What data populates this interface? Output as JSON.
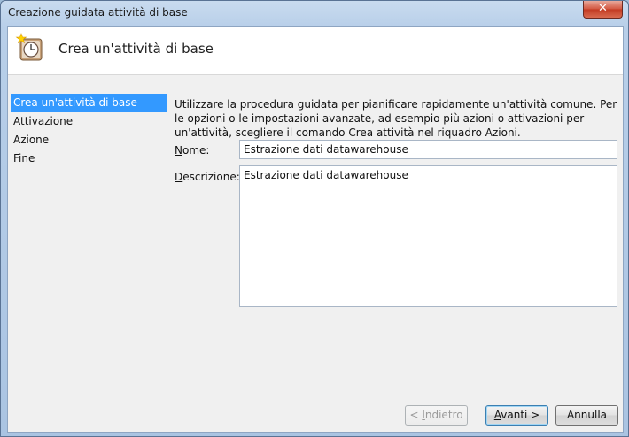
{
  "window": {
    "title": "Creazione guidata attività di base",
    "close_glyph": "✕"
  },
  "header": {
    "title": "Crea un'attività di base",
    "icon": "clock-icon"
  },
  "nav": {
    "items": [
      {
        "label": "Crea un'attività di base",
        "active": true
      },
      {
        "label": "Attivazione"
      },
      {
        "label": "Azione"
      },
      {
        "label": "Fine"
      }
    ]
  },
  "content": {
    "description": "Utilizzare la procedura guidata per pianificare rapidamente un'attività comune. Per le opzioni o le impostazioni avanzate, ad esempio più azioni o attivazioni per un'attività, scegliere il comando Crea attività nel riquadro Azioni.",
    "name_label_accel": "N",
    "name_label_rest": "ome:",
    "name_value": "Estrazione dati datawarehouse",
    "desc_label_accel": "D",
    "desc_label_rest": "escrizione:",
    "desc_value": "Estrazione dati datawarehouse"
  },
  "buttons": {
    "back_prefix": "< ",
    "back_accel": "I",
    "back_rest": "ndietro",
    "next_accel": "A",
    "next_rest": "vanti >",
    "cancel": "Annulla"
  },
  "colors": {
    "selection": "#3399ff",
    "titlebar": "#b8cfe9"
  }
}
